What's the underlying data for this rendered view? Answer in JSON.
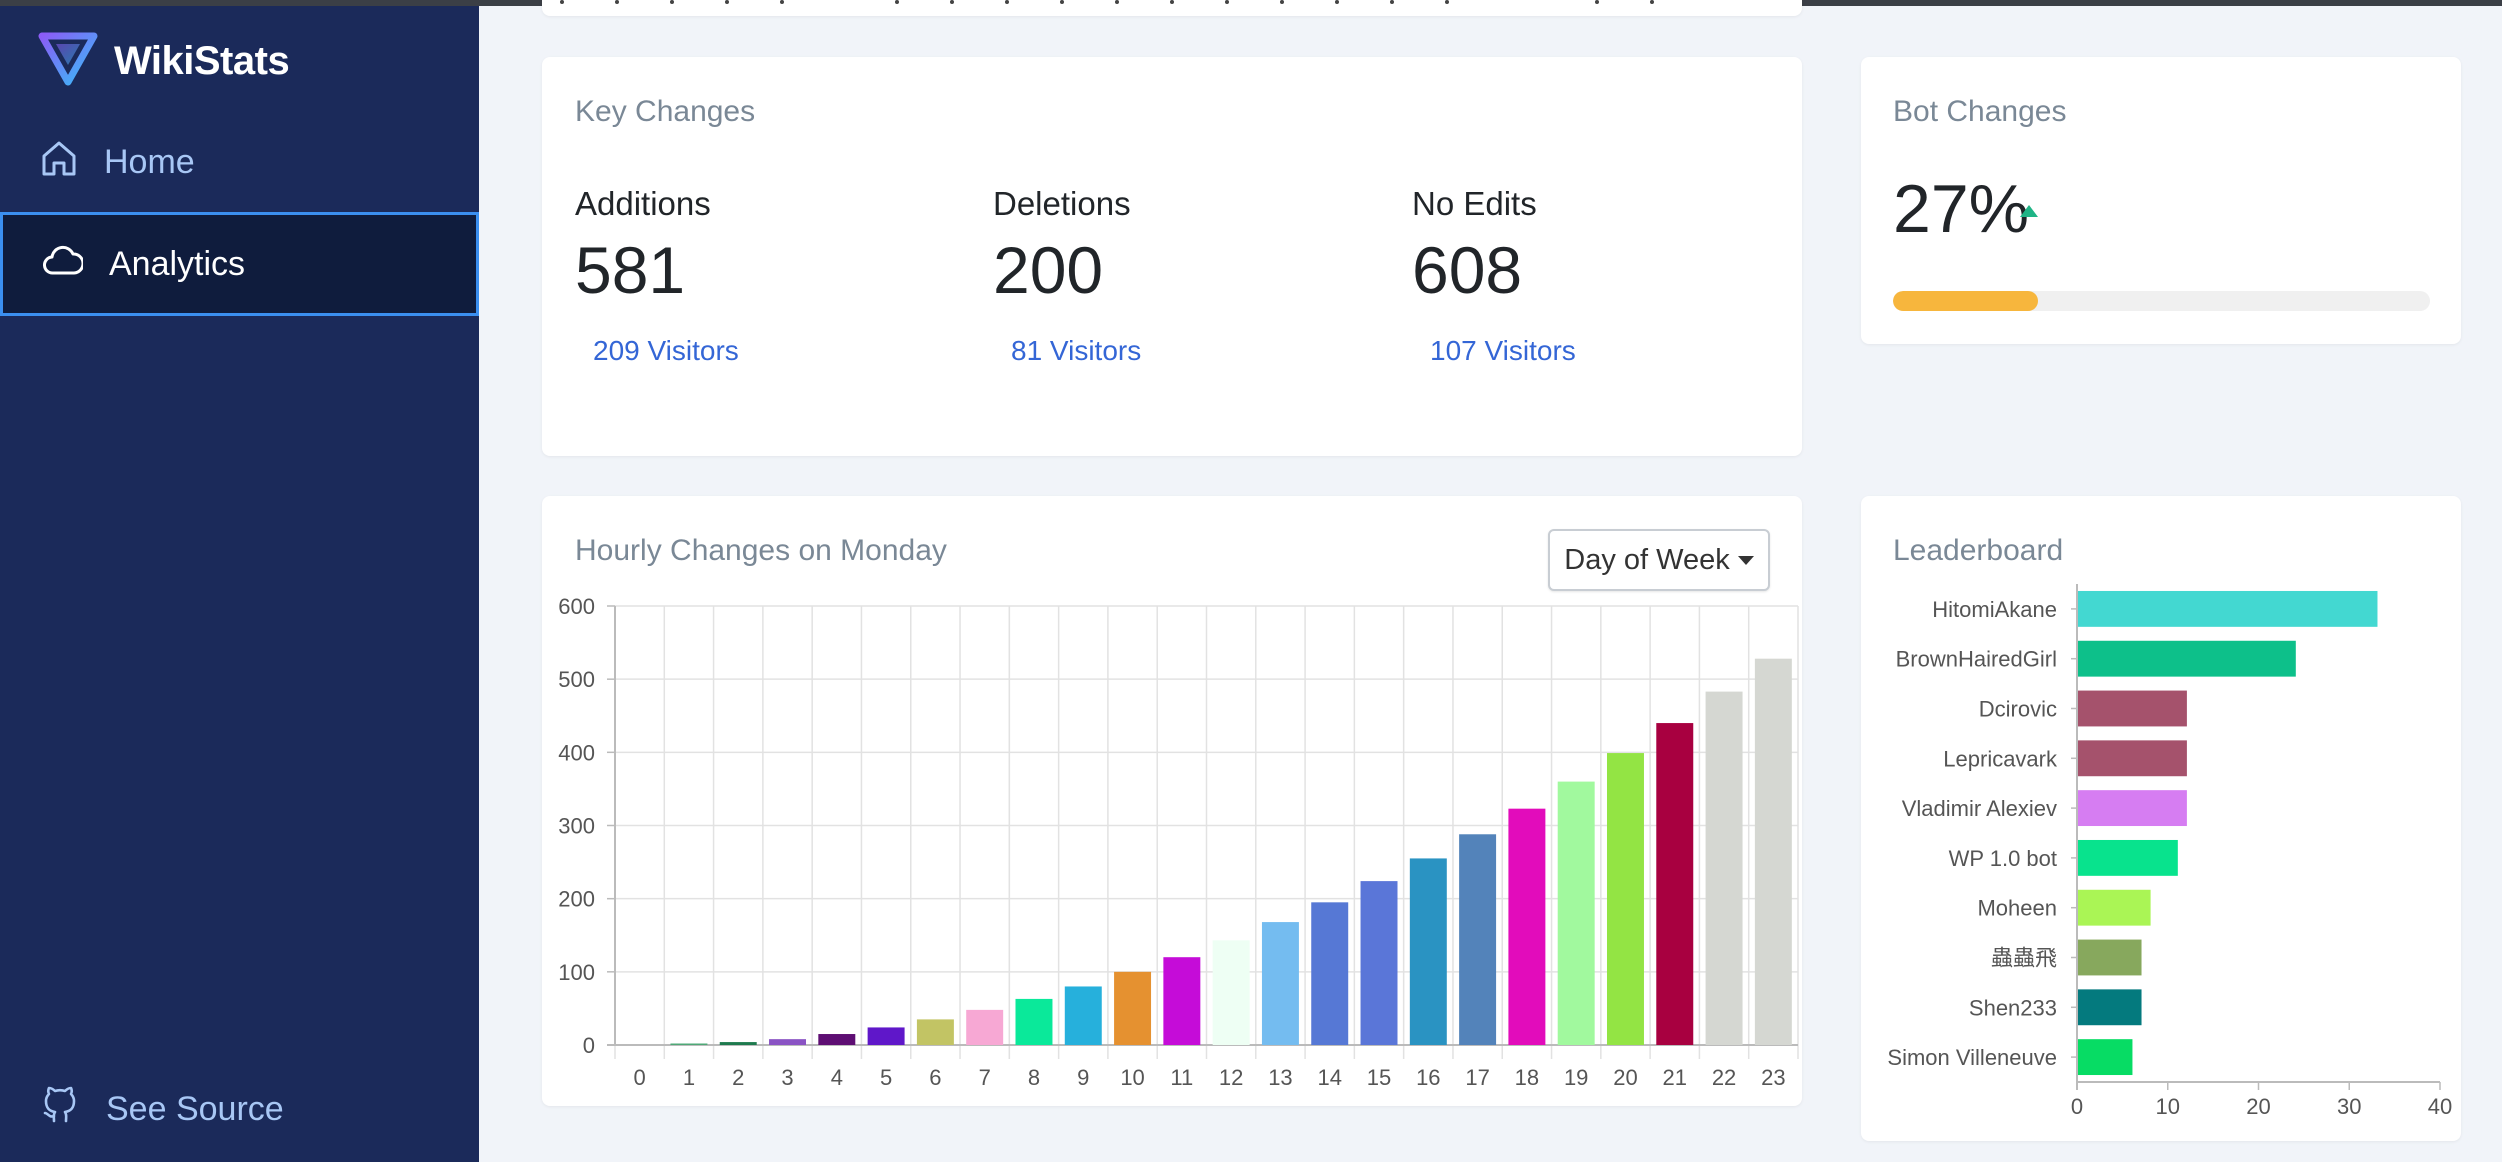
{
  "app": {
    "name": "WikiStats",
    "brand_color": "#7b68ee"
  },
  "sidebar": {
    "items": [
      {
        "label": "Home",
        "icon": "home-icon",
        "active": false
      },
      {
        "label": "Analytics",
        "icon": "cloud-icon",
        "active": true
      }
    ],
    "footer": {
      "label": "See Source",
      "icon": "github-icon"
    }
  },
  "key_changes": {
    "title": "Key Changes",
    "stats": [
      {
        "label": "Additions",
        "value": "581",
        "visitors": "209 Visitors"
      },
      {
        "label": "Deletions",
        "value": "200",
        "visitors": "81 Visitors"
      },
      {
        "label": "No Edits",
        "value": "608",
        "visitors": "107 Visitors"
      }
    ]
  },
  "bot_changes": {
    "title": "Bot Changes",
    "value": "27%",
    "trend": "up",
    "progress_fraction": 0.27,
    "bar_color": "#f7b63d"
  },
  "hourly": {
    "title": "Hourly Changes on Monday",
    "dropdown_label": "Day of Week"
  },
  "leaderboard": {
    "title": "Leaderboard"
  },
  "chart_data": [
    {
      "type": "bar",
      "title": "Hourly Changes on Monday",
      "categories": [
        "0",
        "1",
        "2",
        "3",
        "4",
        "5",
        "6",
        "7",
        "8",
        "9",
        "10",
        "11",
        "12",
        "13",
        "14",
        "15",
        "16",
        "17",
        "18",
        "19",
        "20",
        "21",
        "22",
        "23"
      ],
      "values": [
        0,
        2,
        4,
        8,
        15,
        24,
        35,
        48,
        63,
        80,
        100,
        120,
        143,
        168,
        195,
        224,
        255,
        288,
        323,
        360,
        399,
        440,
        483,
        528
      ],
      "colors": [
        "#a4d4ee",
        "#4fa877",
        "#1e7a4e",
        "#8a53c4",
        "#5e0e73",
        "#5f17c9",
        "#c2c464",
        "#f7a8d4",
        "#0ae99a",
        "#26b0dc",
        "#e59130",
        "#c50cd8",
        "#eefff4",
        "#74bcf0",
        "#5678d5",
        "#5a76d8",
        "#2a93c2",
        "#5383ba",
        "#e20cbb",
        "#a1f99e",
        "#93e444",
        "#a80040",
        "#d5d7d2",
        "#d5d7d2"
      ],
      "ylim": [
        0,
        600
      ],
      "yticks": [
        0,
        100,
        200,
        300,
        400,
        500,
        600
      ],
      "grid": true
    },
    {
      "type": "bar",
      "orientation": "horizontal",
      "title": "Leaderboard",
      "categories": [
        "HitomiAkane",
        "BrownHairedGirl",
        "Dcirovic",
        "Lepricavark",
        "Vladimir Alexiev",
        "WP 1.0 bot",
        "Moheen",
        "蟲蟲飛",
        "Shen233",
        "Simon Villeneuve"
      ],
      "values": [
        33,
        24,
        12,
        12,
        12,
        11,
        8,
        7,
        7,
        6
      ],
      "colors": [
        "#43d8d1",
        "#0dc08a",
        "#a5526c",
        "#a5526c",
        "#d67df2",
        "#08e38d",
        "#aaf555",
        "#87a85d",
        "#047a7e",
        "#07dc64"
      ],
      "xlim": [
        0,
        40
      ],
      "xticks": [
        0,
        10,
        20,
        30,
        40
      ],
      "grid": false
    }
  ]
}
